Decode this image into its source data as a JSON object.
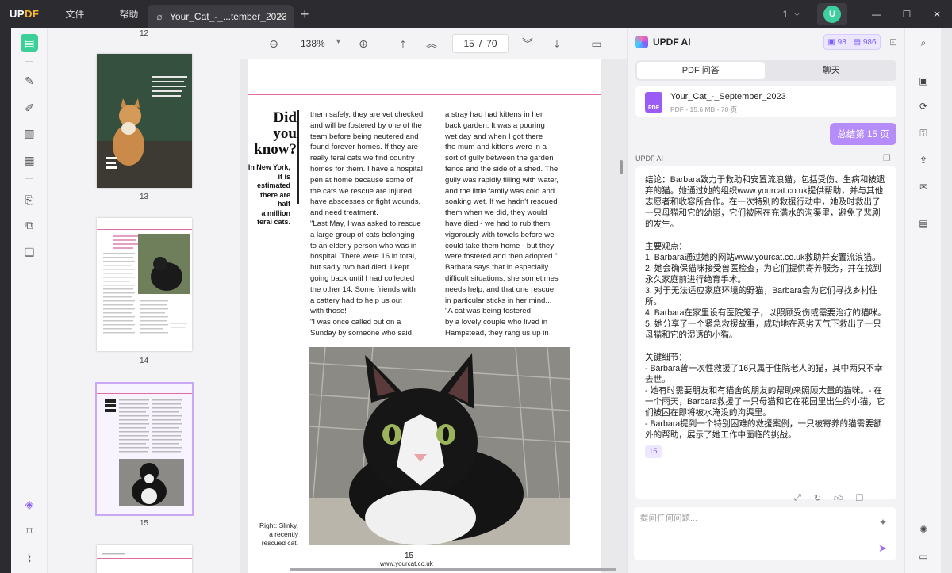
{
  "app": {
    "logo_up": "UP",
    "logo_df": "DF"
  },
  "menu": {
    "file": "文件",
    "help": "帮助"
  },
  "tab": {
    "title": "Your_Cat_-_...tember_2023",
    "close": "✕",
    "add": "+"
  },
  "window": {
    "page_count": "1",
    "avatar": "U",
    "minimize": "—",
    "maximize": "☐",
    "close": "✕"
  },
  "thumbnails": [
    {
      "page": "12"
    },
    {
      "page": "13"
    },
    {
      "page": "14"
    },
    {
      "page": "15"
    }
  ],
  "toolbar": {
    "zoom": "138%",
    "current_page": "15",
    "separator": "/",
    "total_pages": "70"
  },
  "document": {
    "heading_lines": [
      "Did",
      "you",
      "know?"
    ],
    "subheading_lines": [
      "In New York,",
      "it is estimated",
      "there are half",
      "a million",
      "feral cats."
    ],
    "col1": [
      "them safely, they are vet checked,",
      "and will be fostered by one of the",
      "team before being neutered and",
      "found forever homes. If they are",
      "really feral cats we find country",
      "homes for them. I have a hospital",
      "pen at home because some of",
      "the cats we rescue are injured,",
      "have abscesses or fight wounds,",
      "and need treatment.",
      "    \"Last May, I was asked to rescue",
      "a large group of cats belonging",
      "to an elderly person who was in",
      "hospital. There were 16 in total,",
      "but sadly two had died. I kept",
      "going back until I had collected",
      "the other 14. Some friends with",
      "a cattery had to help us out",
      "with those!",
      "    \"I was once called out on a",
      "Sunday by someone who said"
    ],
    "col2": [
      "a stray had had kittens in her",
      "back garden. It was a pouring",
      "wet day and when I got there",
      "the mum and kittens were in a",
      "sort of gully between the garden",
      "fence and the side of a shed. The",
      "gully was rapidly filling with water,",
      "and the little family was cold and",
      "soaking wet. If we hadn't rescued",
      "them when we did, they would",
      "have died - we had to rub them",
      "vigorously with towels before we",
      "could take them home - but they",
      "were fostered and then adopted.\"",
      "    Barbara says that in especially",
      "difficult situations, she sometimes",
      "needs help, and that one rescue",
      "in particular sticks in her mind...",
      "    \"A cat was being fostered",
      "by a lovely couple who lived in",
      "Hampstead, they rang us up in"
    ],
    "caption_lines": [
      "Right: Slinky,",
      "a recently",
      "rescued cat."
    ],
    "page_number": "15",
    "website": "www.yourcat.co.uk"
  },
  "ai": {
    "title": "UPDF AI",
    "credit_a": "98",
    "credit_b": "986",
    "tab_pdf": "PDF 问答",
    "tab_chat": "聊天",
    "file_name": "Your_Cat_-_September_2023",
    "file_meta": "PDF - 15.6 MB - 70 页",
    "file_icon": "PDF",
    "user_message": "总结第 15 页",
    "label": "UPDF AI",
    "answer_paragraphs": [
      "结论：Barbara致力于救助和安置流浪猫，包括受伤、生病和被遗弃的猫。她通过她的组织www.yourcat.co.uk提供帮助，并与其他志愿者和收容所合作。在一次特别的救援行动中，她及时救出了一只母猫和它的幼崽，它们被困在充满水的沟渠里，避免了悲剧的发生。",
      "",
      "主要观点：",
      "1. Barbara通过她的网站www.yourcat.co.uk救助并安置流浪猫。",
      "2. 她会确保猫咪接受兽医检查，为它们提供寄养服务，并在找到永久家庭前进行绝育手术。",
      "3. 对于无法适应家庭环境的野猫，Barbara会为它们寻找乡村住所。",
      "4. Barbara在家里设有医院笼子，以照顾受伤或需要治疗的猫咪。",
      "5. 她分享了一个紧急救援故事，成功地在恶劣天气下救出了一只母猫和它的湿透的小猫。",
      "",
      "关键细节：",
      "- Barbara曾一次性救援了16只属于住院老人的猫，其中两只不幸去世。",
      "- 她有时需要朋友和有猫舍的朋友的帮助来照顾大量的猫咪。- 在一个雨天，Barbara救援了一只母猫和它在花园里出生的小猫，它们被困在即将被水淹没的沟渠里。",
      "- Barbara提到一个特别困难的救援案例，一只被寄养的猫需要额外的帮助，展示了她工作中面临的挑战。"
    ],
    "reference": "15",
    "input_placeholder": "提问任何问题..."
  },
  "colors": {
    "accent_purple": "#b58cf9",
    "pink_rule": "#e06cab",
    "green": "#3ccf9a"
  }
}
